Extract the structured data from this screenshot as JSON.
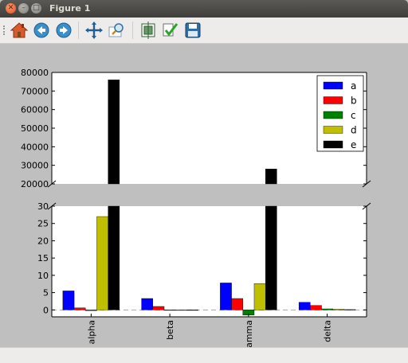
{
  "window": {
    "title": "Figure 1"
  },
  "toolbar": {
    "buttons": [
      {
        "name": "home-icon"
      },
      {
        "name": "back-icon"
      },
      {
        "name": "forward-icon"
      },
      {
        "name": "pan-icon"
      },
      {
        "name": "zoom-icon"
      },
      {
        "name": "subplots-icon"
      },
      {
        "name": "edit-icon"
      },
      {
        "name": "save-icon"
      }
    ]
  },
  "chart_data": {
    "type": "bar",
    "categories": [
      "alpha",
      "beta",
      "gamma",
      "delta"
    ],
    "series": [
      {
        "name": "a",
        "color": "#0000ff",
        "values": [
          5.5,
          3.3,
          7.8,
          2.2
        ]
      },
      {
        "name": "b",
        "color": "#ff0000",
        "values": [
          0.6,
          1.0,
          3.3,
          1.3
        ]
      },
      {
        "name": "c",
        "color": "#008000",
        "values": [
          -0.2,
          -0.1,
          -1.5,
          0.3
        ]
      },
      {
        "name": "d",
        "color": "#bfbf00",
        "values": [
          27.0,
          -0.1,
          7.6,
          0.2
        ]
      },
      {
        "name": "e",
        "color": "#000000",
        "values": [
          76000,
          -0.1,
          28000,
          0.1
        ]
      }
    ],
    "broken_axis": true,
    "top_axis": {
      "ylim": [
        20000,
        80000
      ],
      "ticks": [
        "20000",
        "30000",
        "40000",
        "50000",
        "60000",
        "70000",
        "80000"
      ]
    },
    "bottom_axis": {
      "ylim": [
        -2,
        30
      ],
      "ticks": [
        "0",
        "5",
        "10",
        "15",
        "20",
        "25",
        "30"
      ]
    },
    "reference_line": {
      "y": 0,
      "style": "dashed",
      "color": "#a8a8a8"
    },
    "legend": {
      "placement": "top-right"
    },
    "grid": false,
    "title": "",
    "xlabel": "",
    "ylabel": ""
  }
}
